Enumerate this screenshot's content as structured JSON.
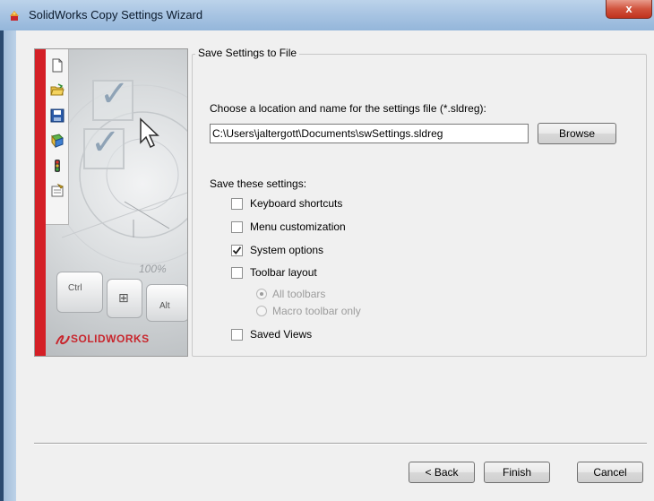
{
  "window": {
    "title": "SolidWorks Copy Settings Wizard",
    "close_label": "x"
  },
  "sidebar": {
    "brand": "SOLIDWORKS",
    "brand_prefix": "3S",
    "zoom_text": "100%",
    "key_ctrl": "Ctrl",
    "key_alt": "Alt",
    "tools": [
      "new-document-icon",
      "open-folder-icon",
      "save-icon",
      "options-icon",
      "traffic-light-icon",
      "properties-icon"
    ]
  },
  "group": {
    "title": "Save Settings to File",
    "choose_label": "Choose a location and name for the settings file (*.sldreg):",
    "path_value": "C:\\Users\\jaltergott\\Documents\\swSettings.sldreg",
    "browse_label": "Browse",
    "save_settings_label": "Save these settings:",
    "options": [
      {
        "label": "Keyboard shortcuts",
        "checked": false
      },
      {
        "label": "Menu customization",
        "checked": false
      },
      {
        "label": "System options",
        "checked": true
      },
      {
        "label": "Toolbar layout",
        "checked": false
      },
      {
        "label": "Saved Views",
        "checked": false
      }
    ],
    "toolbar_radios": [
      {
        "label": "All toolbars",
        "selected": true
      },
      {
        "label": "Macro toolbar only",
        "selected": false
      }
    ]
  },
  "footer": {
    "back_label": "< Back",
    "finish_label": "Finish",
    "cancel_label": "Cancel"
  },
  "colors": {
    "accent_red": "#d41f26",
    "title_bar": "#a9c5e3",
    "close_button": "#c0321d"
  }
}
